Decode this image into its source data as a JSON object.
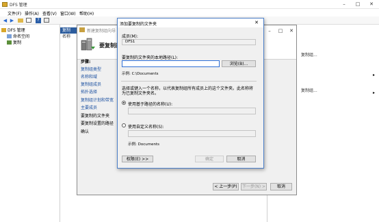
{
  "window": {
    "title": "DFS 管理"
  },
  "menu": [
    "文件(F)",
    "操作(A)",
    "查看(V)",
    "窗口(W)",
    "帮助(H)"
  ],
  "toolbar": {
    "icons": [
      "back-arrow",
      "forward-arrow",
      "folder",
      "tree-view",
      "help",
      "panel"
    ]
  },
  "tree": {
    "root": "DFS 管理",
    "items": [
      "命名空间",
      "复制"
    ]
  },
  "center": {
    "header": "复制",
    "column": "名称"
  },
  "right": {
    "items": [
      "",
      "复制组...",
      "",
      "复制组..."
    ]
  },
  "wizard": {
    "title": "新建复制组向导",
    "heading": "要复制的",
    "steps_title": "步骤:",
    "steps": [
      "复制组类型",
      "名称和域",
      "复制组成员",
      "拓扑选择",
      "复制组计划和带宽",
      "主要成员",
      "要复制的文件夹",
      "要复制设置的路径",
      "确认"
    ],
    "current_step_index": 6,
    "buttons": {
      "prev": "< 上一步(P)",
      "next": "下一步(N) >",
      "cancel": "取消"
    }
  },
  "dialog": {
    "title": "添加要复制的文件夹",
    "member_label": "成员(M):",
    "member_value": "DFS1",
    "local_path_label": "要复制的文件夹的本地路径(L):",
    "local_path_value": "",
    "browse_button": "浏览(B)...",
    "example1": "示例: C:\\Documents",
    "description": "选择或键入一个名称，以代表复制组所有成员上的这个文件夹。此名称将为已复制文件夹名。",
    "option_basename_label": "使用基于路径的名称(U):",
    "option_basename_checked": true,
    "option_basename_value": "",
    "option_custom_label": "使用自定义名称(S):",
    "option_custom_checked": false,
    "option_custom_value": "",
    "example2": "示例: Documents",
    "permissions_button": "权限(E) >>",
    "ok_button": "确定",
    "cancel_button": "取消"
  }
}
